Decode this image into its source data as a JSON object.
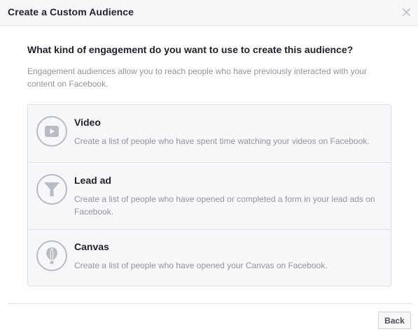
{
  "dialog": {
    "title": "Create a Custom Audience",
    "close_symbol": "×"
  },
  "main": {
    "question": "What kind of engagement do you want to use to create this audience?",
    "description": "Engagement audiences allow you to reach people who have previously interacted with your content on Facebook."
  },
  "options": [
    {
      "icon": "play-video-icon",
      "title": "Video",
      "description": "Create a list of people who have spent time watching your videos on Facebook."
    },
    {
      "icon": "funnel-icon",
      "title": "Lead ad",
      "description": "Create a list of people who have opened or completed a form in your lead ads on Facebook."
    },
    {
      "icon": "canvas-balloon-icon",
      "title": "Canvas",
      "description": "Create a list of people who have opened your Canvas on Facebook."
    }
  ],
  "footer": {
    "back_label": "Back"
  },
  "colors": {
    "header_bg": "#f6f7f9",
    "text_primary": "#1d2129",
    "text_secondary": "#90949c",
    "icon_gray": "#b7bbc2",
    "border": "#dddfe2"
  }
}
